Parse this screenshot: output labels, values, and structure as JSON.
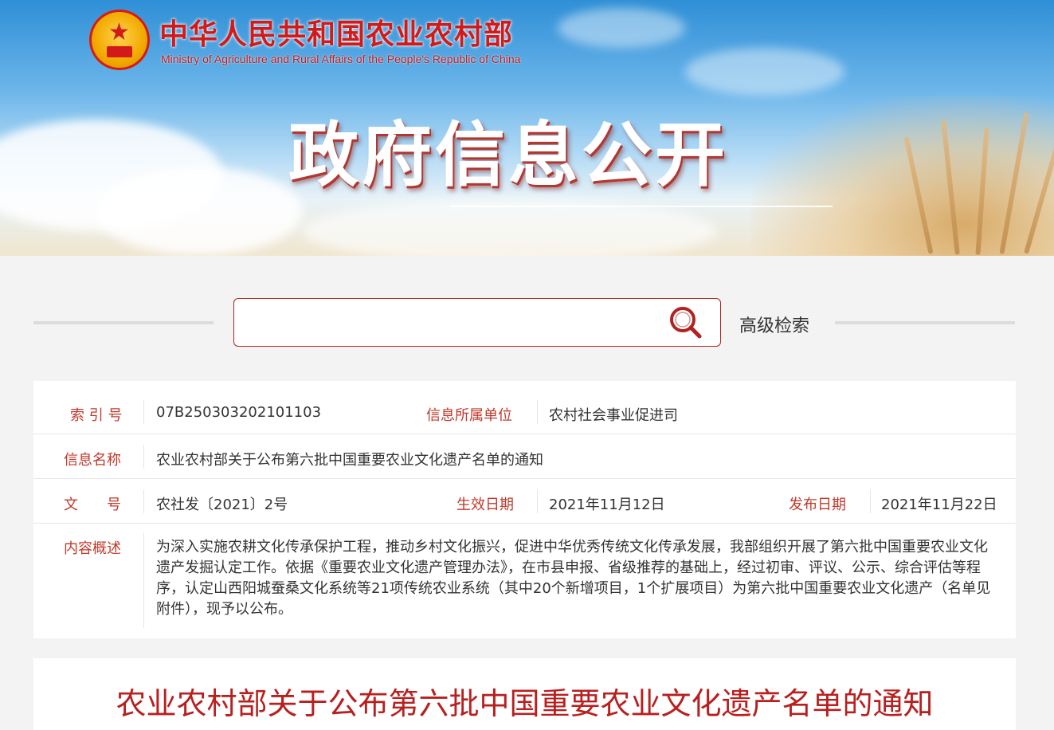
{
  "header": {
    "site_name_cn": "中华人民共和国农业农村部",
    "site_name_en": "Ministry of Agriculture and Rural Affairs of the People's Republic of China",
    "banner_title": "政府信息公开"
  },
  "search": {
    "placeholder": "",
    "advanced_label": "高级检索"
  },
  "info": {
    "index_label": "索 引 号",
    "index_value": "07B250303202101103",
    "unit_label": "信息所属单位",
    "unit_value": "农村社会事业促进司",
    "name_label": "信息名称",
    "name_value": "农业农村部关于公布第六批中国重要农业文化遗产名单的通知",
    "docno_label": "文　　号",
    "docno_value": "农社发〔2021〕2号",
    "effective_label": "生效日期",
    "effective_value": "2021年11月12日",
    "publish_label": "发布日期",
    "publish_value": "2021年11月22日",
    "summary_label": "内容概述",
    "summary_value": "为深入实施农耕文化传承保护工程，推动乡村文化振兴，促进中华优秀传统文化传承发展，我部组织开展了第六批中国重要农业文化遗产发掘认定工作。依据《重要农业文化遗产管理办法》，在市县申报、省级推荐的基础上，经过初审、评议、公示、综合评估等程序，认定山西阳城蚕桑文化系统等21项传统农业系统（其中20个新增项目，1个扩展项目）为第六批中国重要农业文化遗产（名单见附件），现予以公布。"
  },
  "document": {
    "title": "农业农村部关于公布第六批中国重要农业文化遗产名单的通知"
  },
  "colors": {
    "accent_red": "#c0392b",
    "brand_red": "#d11b1b",
    "sky_blue": "#2f8fd6"
  }
}
